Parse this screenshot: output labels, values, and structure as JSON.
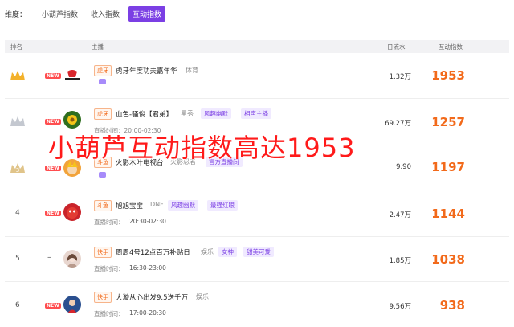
{
  "dimensions": {
    "label": "维度：",
    "options": [
      "小葫芦指数",
      "收入指数",
      "互动指数"
    ],
    "active_index": 2
  },
  "table": {
    "headers": {
      "rank": "排名",
      "anchor": "主播",
      "daily_flow": "日流水",
      "index": "互动指数"
    },
    "rows": [
      {
        "rank": "",
        "rank_icon": "gold-crown-icon",
        "badge": "NEW",
        "platform": "虎牙",
        "name": "虎牙年度功夫嘉年华",
        "category": "体育",
        "tags": [],
        "live_time": "",
        "daily_flow": "1.32万",
        "index": "1953"
      },
      {
        "rank": "",
        "rank_icon": "silver-crown-icon",
        "badge": "NEW",
        "platform": "虎牙",
        "name": "血色-骚俊【君弟】",
        "category": "星秀",
        "tags": [
          "风趣幽默",
          "相声主播"
        ],
        "live_time": "直播时间：20:00-02:30",
        "daily_flow": "69.27万",
        "index": "1257"
      },
      {
        "rank": "3",
        "rank_icon": "bronze-crown-icon",
        "badge": "NEW",
        "platform": "斗鱼",
        "name": "火影木叶电视台",
        "category": "火影忍者",
        "tags": [
          "官方直播间"
        ],
        "live_time": "",
        "daily_flow": "9.90",
        "index": "1197"
      },
      {
        "rank": "4",
        "rank_icon": "",
        "badge": "NEW",
        "platform": "斗鱼",
        "name": "旭旭宝宝",
        "category": "DNF",
        "tags": [
          "风趣幽默",
          "最强红眼"
        ],
        "live_time_label": "直播时间：",
        "live_time": "20:30-02:30",
        "daily_flow": "2.47万",
        "index": "1144"
      },
      {
        "rank": "5",
        "rank_icon": "",
        "badge": "–",
        "platform": "快手",
        "name": "周周4号12点百万补贴日",
        "category": "娱乐",
        "tags": [
          "女神",
          "甜美可爱"
        ],
        "live_time_label": "直播时间：",
        "live_time": "16:30-23:00",
        "daily_flow": "1.85万",
        "index": "1038"
      },
      {
        "rank": "6",
        "rank_icon": "",
        "badge": "NEW",
        "platform": "快手",
        "name": "大漩从心出发9.5送千万",
        "category": "娱乐",
        "tags": [],
        "live_time_label": "直播时间：",
        "live_time": "17:00-20:30",
        "daily_flow": "9.56万",
        "index": "938"
      }
    ]
  },
  "overlay_caption": "小葫芦互动指数高达1953",
  "colors": {
    "accent": "#7b3fe4",
    "index": "#f26a1b",
    "overlay": "#ff1a1a",
    "badge": "#ff4d4f"
  }
}
